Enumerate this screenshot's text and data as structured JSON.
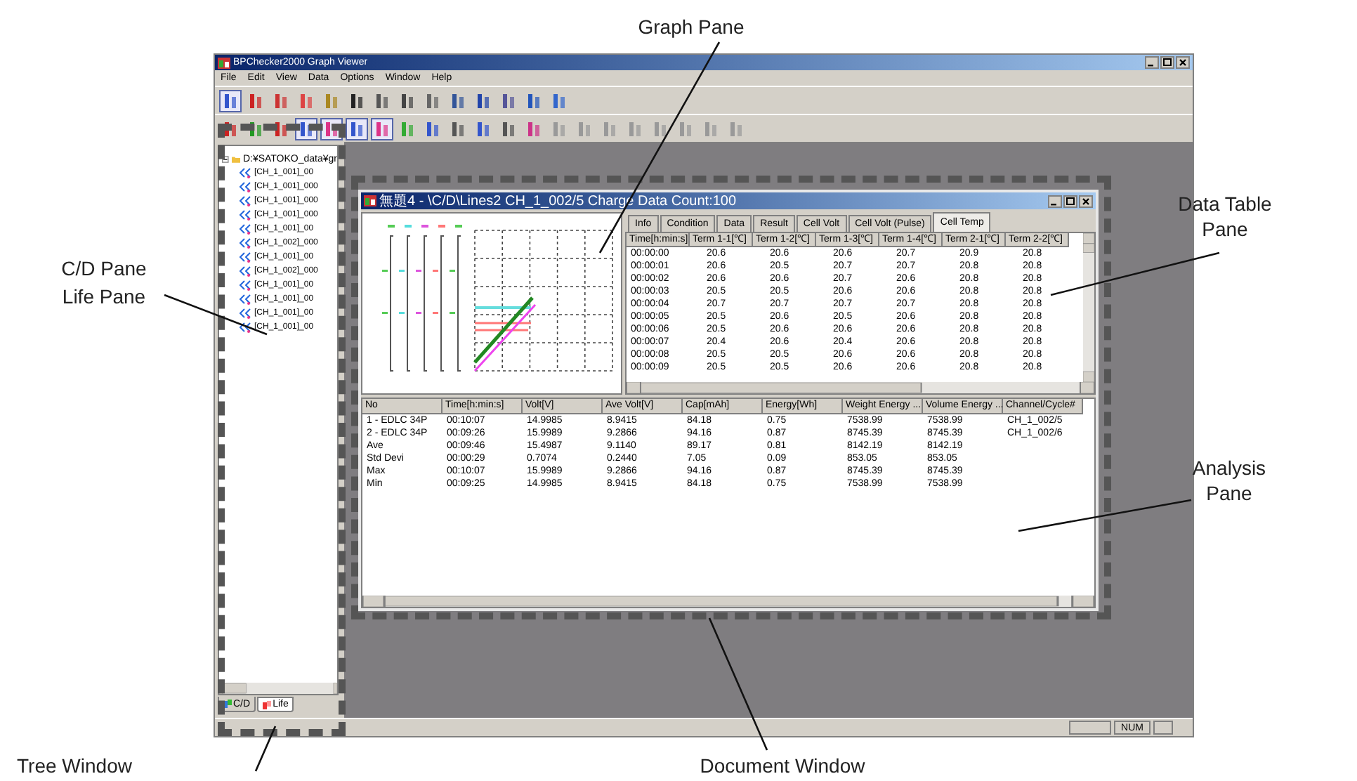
{
  "window": {
    "title": "BPChecker2000 Graph Viewer"
  },
  "menu": [
    "File",
    "Edit",
    "View",
    "Data",
    "Options",
    "Window",
    "Help"
  ],
  "tree": {
    "label": "D:¥SATOKO_data¥gr",
    "expanded": true,
    "children": [
      {
        "label": "[CH_1_001]_00"
      },
      {
        "label": "[CH_1_001]_000"
      },
      {
        "label": "[CH_1_001]_000"
      },
      {
        "label": "[CH_1_001]_000"
      },
      {
        "label": "[CH_1_001]_00"
      },
      {
        "label": "[CH_1_002]_000"
      },
      {
        "label": "[CH_1_001]_00"
      },
      {
        "label": "[CH_1_002]_000"
      },
      {
        "label": "[CH_1_001]_00"
      },
      {
        "label": "[CH_1_001]_00"
      },
      {
        "label": "[CH_1_001]_00"
      },
      {
        "label": "[CH_1_001]_00"
      }
    ]
  },
  "tree_tabs": [
    {
      "label": "C/D",
      "selected": false
    },
    {
      "label": "Life",
      "selected": true
    }
  ],
  "document": {
    "title": "無題4 - \\C/D\\Lines2  CH_1_002/5 Charge Data Count:100",
    "tabs": [
      {
        "label": "Info",
        "selected": false
      },
      {
        "label": "Condition",
        "selected": false
      },
      {
        "label": "Data",
        "selected": false
      },
      {
        "label": "Result",
        "selected": false
      },
      {
        "label": "Cell Volt",
        "selected": false
      },
      {
        "label": "Cell Volt (Pulse)",
        "selected": false
      },
      {
        "label": "Cell Temp",
        "selected": true
      }
    ],
    "data_table": {
      "columns": [
        "Time[h:min:s]",
        "Term 1-1[℃]",
        "Term 1-2[℃]",
        "Term 1-3[℃]",
        "Term 1-4[℃]",
        "Term 2-1[℃]",
        "Term 2-2[℃]"
      ],
      "rows": [
        [
          "00:00:00",
          "20.6",
          "20.6",
          "20.6",
          "20.7",
          "20.9",
          "20.8"
        ],
        [
          "00:00:01",
          "20.6",
          "20.5",
          "20.7",
          "20.7",
          "20.8",
          "20.8"
        ],
        [
          "00:00:02",
          "20.6",
          "20.6",
          "20.7",
          "20.6",
          "20.8",
          "20.8"
        ],
        [
          "00:00:03",
          "20.5",
          "20.5",
          "20.6",
          "20.6",
          "20.8",
          "20.8"
        ],
        [
          "00:00:04",
          "20.7",
          "20.7",
          "20.7",
          "20.7",
          "20.8",
          "20.8"
        ],
        [
          "00:00:05",
          "20.5",
          "20.6",
          "20.5",
          "20.6",
          "20.8",
          "20.8"
        ],
        [
          "00:00:06",
          "20.5",
          "20.6",
          "20.6",
          "20.6",
          "20.8",
          "20.8"
        ],
        [
          "00:00:07",
          "20.4",
          "20.6",
          "20.4",
          "20.6",
          "20.8",
          "20.8"
        ],
        [
          "00:00:08",
          "20.5",
          "20.5",
          "20.6",
          "20.6",
          "20.8",
          "20.8"
        ],
        [
          "00:00:09",
          "20.5",
          "20.5",
          "20.6",
          "20.6",
          "20.8",
          "20.8"
        ]
      ]
    },
    "analysis": {
      "columns": [
        "No",
        "Time[h:min:s]",
        "Volt[V]",
        "Ave Volt[V]",
        "Cap[mAh]",
        "Energy[Wh]",
        "Weight Energy ...",
        "Volume Energy ...",
        "Channel/Cycle#"
      ],
      "rows": [
        [
          "1 - EDLC 34P",
          "00:10:07",
          "14.9985",
          "8.9415",
          "84.18",
          "0.75",
          "7538.99",
          "7538.99",
          "CH_1_002/5"
        ],
        [
          "2 - EDLC 34P",
          "00:09:26",
          "15.9989",
          "9.2866",
          "94.16",
          "0.87",
          "8745.39",
          "8745.39",
          "CH_1_002/6"
        ],
        [
          "Ave",
          "00:09:46",
          "15.4987",
          "9.1140",
          "89.17",
          "0.81",
          "8142.19",
          "8142.19"
        ],
        [
          "Std Devi",
          "00:00:29",
          "0.7074",
          "0.2440",
          "7.05",
          "0.09",
          "853.05",
          "853.05"
        ],
        [
          "Max",
          "00:10:07",
          "15.9989",
          "9.2866",
          "94.16",
          "0.87",
          "8745.39",
          "8745.39"
        ],
        [
          "Min",
          "00:09:25",
          "14.9985",
          "8.9415",
          "84.18",
          "0.75",
          "7538.99",
          "7538.99"
        ]
      ]
    }
  },
  "status_bar": {
    "indicator": "NUM"
  },
  "callouts": [
    "Graph Pane",
    "Data Table Pane",
    "C/D Pane",
    "Life Pane",
    "Analysis Pane",
    "Tree Window",
    "Document Window"
  ]
}
